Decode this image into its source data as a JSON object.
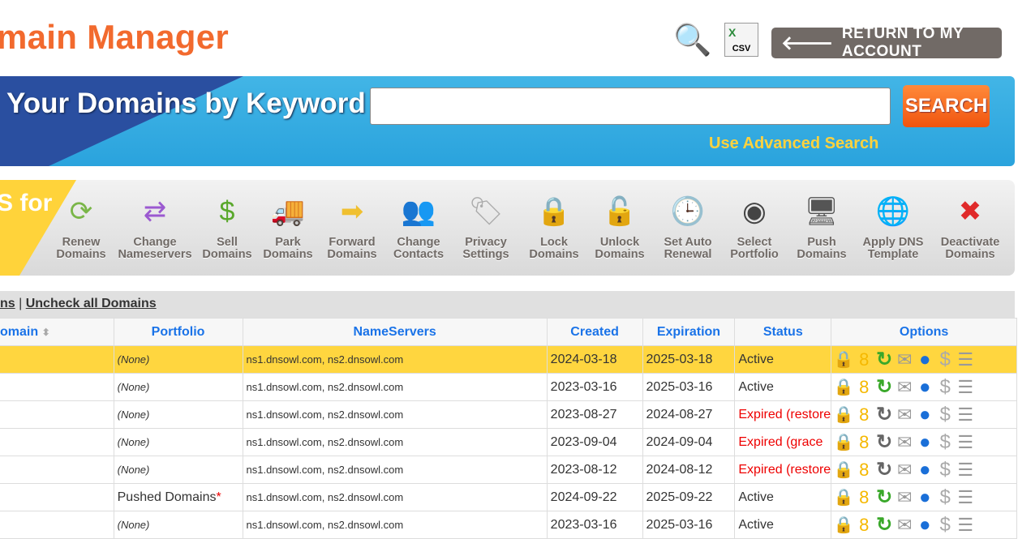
{
  "header": {
    "title": "main Manager",
    "return_label": "RETURN TO MY ACCOUNT",
    "csv_label": "CSV"
  },
  "search": {
    "heading": "Your Domains by Keyword",
    "value": "",
    "button": "SEARCH",
    "advanced": "Use Advanced Search"
  },
  "promo": {
    "text": "S for"
  },
  "toolbar": [
    {
      "label1": "Renew",
      "label2": "Domains",
      "icon": "renew-icon",
      "glyph": "⟳",
      "color": "#7ab648"
    },
    {
      "label1": "Change",
      "label2": "Nameservers",
      "icon": "swap-arrows-icon",
      "glyph": "⇄",
      "color": "#9b59d0"
    },
    {
      "label1": "Sell",
      "label2": "Domains",
      "icon": "dollar-icon",
      "glyph": "$",
      "color": "#5aa82c"
    },
    {
      "label1": "Park",
      "label2": "Domains",
      "icon": "truck-icon",
      "glyph": "🚚",
      "color": "#e04a2a"
    },
    {
      "label1": "Forward",
      "label2": "Domains",
      "icon": "arrow-right-icon",
      "glyph": "➡",
      "color": "#f0c030"
    },
    {
      "label1": "Change",
      "label2": "Contacts",
      "icon": "contacts-icon",
      "glyph": "👥",
      "color": "#2a7ec0"
    },
    {
      "label1": "Privacy",
      "label2": "Settings",
      "icon": "tag-icon",
      "glyph": "🏷",
      "color": "#aaa"
    },
    {
      "label1": "Lock",
      "label2": "Domains",
      "icon": "lock-icon",
      "glyph": "🔒",
      "color": "#e8a030"
    },
    {
      "label1": "Unlock",
      "label2": "Domains",
      "icon": "unlock-icon",
      "glyph": "🔓",
      "color": "#e8a030"
    },
    {
      "label1": "Set Auto",
      "label2": "Renewal",
      "icon": "clock-icon",
      "glyph": "🕒",
      "color": "#2a9ad0"
    },
    {
      "label1": "Select",
      "label2": "Portfolio",
      "icon": "gauge-icon",
      "glyph": "◉",
      "color": "#444"
    },
    {
      "label1": "Push",
      "label2": "Domains",
      "icon": "monitors-icon",
      "glyph": "🖥",
      "color": "#555"
    },
    {
      "label1": "Apply DNS",
      "label2": "Template",
      "icon": "dns-template-icon",
      "glyph": "🌐",
      "color": "#2a7ed0"
    },
    {
      "label1": "Deactivate",
      "label2": "Domains",
      "icon": "deactivate-icon",
      "glyph": "✖",
      "color": "#e02a2a"
    }
  ],
  "selection": {
    "check_all": "ns",
    "separator": " | ",
    "uncheck_all": "Uncheck all Domains"
  },
  "table": {
    "headers": {
      "domain": "omain",
      "portfolio": "Portfolio",
      "nameservers": "NameServers",
      "created": "Created",
      "expiration": "Expiration",
      "status": "Status",
      "options": "Options"
    },
    "rows": [
      {
        "portfolio": "(None)",
        "ns": "ns1.dnsowl.com, ns2.dnsowl.com",
        "created": "2024-03-18",
        "expiration": "2025-03-18",
        "status": "Active",
        "expired": false,
        "renew_active": true,
        "selected": true
      },
      {
        "portfolio": "(None)",
        "ns": "ns1.dnsowl.com, ns2.dnsowl.com",
        "created": "2023-03-16",
        "expiration": "2025-03-16",
        "status": "Active",
        "expired": false,
        "renew_active": true
      },
      {
        "portfolio": "(None)",
        "ns": "ns1.dnsowl.com, ns2.dnsowl.com",
        "created": "2023-08-27",
        "expiration": "2024-08-27",
        "status": "Expired (restore",
        "expired": true,
        "renew_active": false
      },
      {
        "portfolio": "(None)",
        "ns": "ns1.dnsowl.com, ns2.dnsowl.com",
        "created": "2023-09-04",
        "expiration": "2024-09-04",
        "status": "Expired (grace",
        "expired": true,
        "renew_active": false
      },
      {
        "portfolio": "(None)",
        "ns": "ns1.dnsowl.com, ns2.dnsowl.com",
        "created": "2023-08-12",
        "expiration": "2024-08-12",
        "status": "Expired (restore",
        "expired": true,
        "renew_active": false
      },
      {
        "portfolio": "Pushed Domains",
        "portfolio_mark": "*",
        "ns": "ns1.dnsowl.com, ns2.dnsowl.com",
        "created": "2024-09-22",
        "expiration": "2025-09-22",
        "status": "Active",
        "expired": false,
        "renew_active": true
      },
      {
        "portfolio": "(None)",
        "ns": "ns1.dnsowl.com, ns2.dnsowl.com",
        "created": "2023-03-16",
        "expiration": "2025-03-16",
        "status": "Active",
        "expired": false,
        "renew_active": true
      }
    ]
  }
}
